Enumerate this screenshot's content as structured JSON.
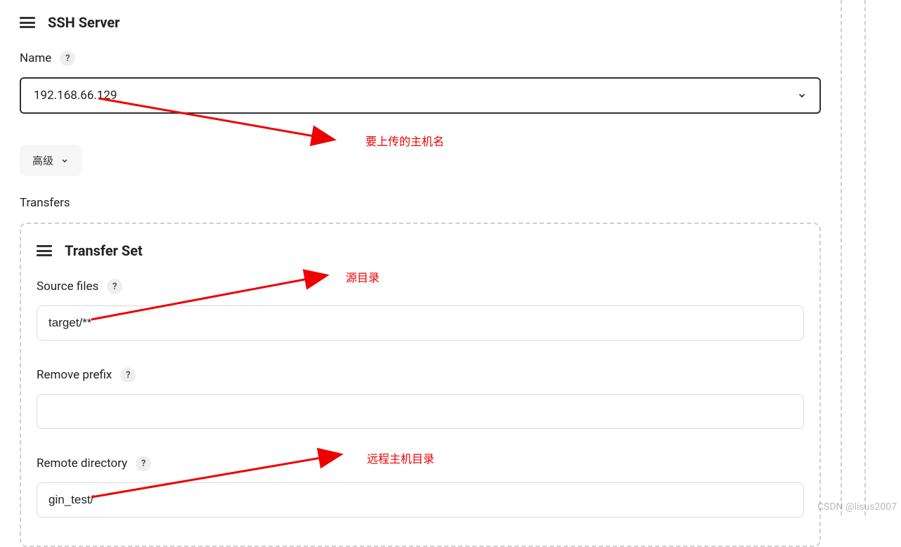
{
  "sshServer": {
    "title": "SSH Server",
    "nameLabel": "Name",
    "selectedName": "192.168.66.129",
    "advancedLabel": "高级"
  },
  "transfers": {
    "label": "Transfers",
    "setTitle": "Transfer Set",
    "sourceFilesLabel": "Source files",
    "sourceFilesValue": "target/**",
    "removePrefixLabel": "Remove prefix",
    "removePrefixValue": "",
    "remoteDirectoryLabel": "Remote directory",
    "remoteDirectoryValue": "gin_test/"
  },
  "annotations": {
    "hostname": "要上传的主机名",
    "sourceDir": "源目录",
    "remoteDir": "远程主机目录"
  },
  "icons": {
    "helpSymbol": "?"
  },
  "watermark": "CSDN @lisus2007"
}
